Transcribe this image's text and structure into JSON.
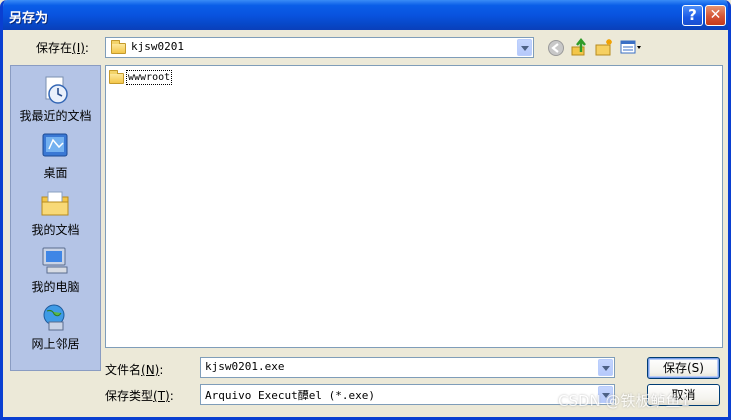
{
  "window": {
    "title": "另存为",
    "help_glyph": "?",
    "close_glyph": "✕"
  },
  "save_in": {
    "label": "保存在",
    "hotkey": "(I)",
    "colon": ":",
    "value": "kjsw0201"
  },
  "toolbar": {
    "back_icon": "back-arrow-icon",
    "up_icon": "up-folder-icon",
    "new_folder_icon": "new-folder-icon",
    "views_icon": "views-menu-icon"
  },
  "places": [
    {
      "label": "我最近的文档",
      "icon": "recent-documents-icon"
    },
    {
      "label": "桌面",
      "icon": "desktop-icon"
    },
    {
      "label": "我的文档",
      "icon": "my-documents-icon"
    },
    {
      "label": "我的电脑",
      "icon": "my-computer-icon"
    },
    {
      "label": "网上邻居",
      "icon": "network-places-icon"
    }
  ],
  "files": [
    {
      "name": "wwwroot",
      "type": "folder"
    }
  ],
  "filename": {
    "label": "文件名",
    "hotkey": "(N)",
    "colon": ":",
    "value": "kjsw0201.exe"
  },
  "filetype": {
    "label": "保存类型",
    "hotkey": "(T)",
    "colon": ":",
    "value": "Arquivo Execut醰el (*.exe)"
  },
  "buttons": {
    "save": "保存(S)",
    "cancel": "取消"
  },
  "watermark": "CSDN @铁板鲈鱼1"
}
